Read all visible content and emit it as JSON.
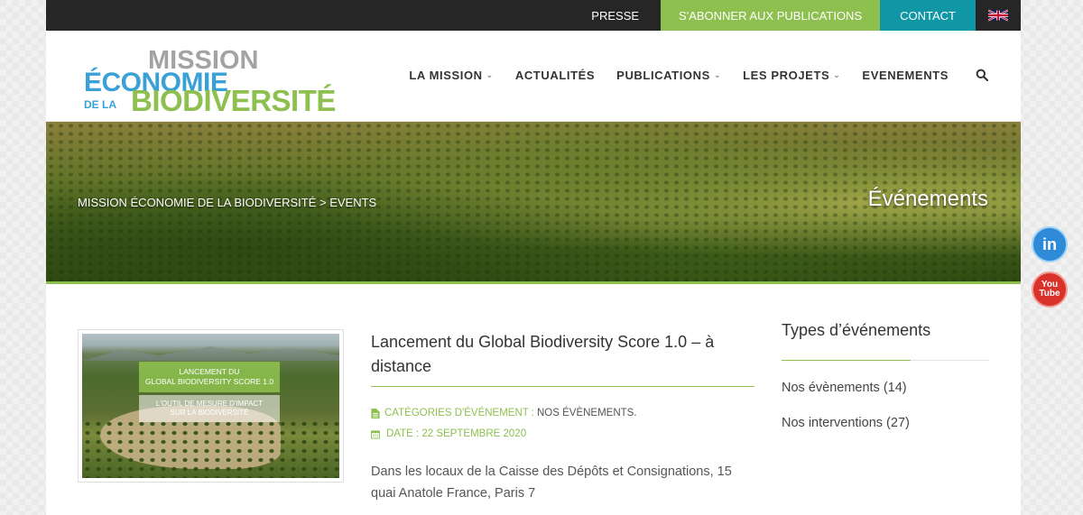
{
  "topbar": {
    "press": "PRESSE",
    "subscribe": "S'ABONNER AUX PUBLICATIONS",
    "contact": "CONTACT",
    "language_flag": "uk-flag-icon"
  },
  "logo": {
    "line1": "MISSION",
    "line2": "ÉCONOMIE",
    "line3": "DE LA",
    "line4": "BIODIVERSITÉ"
  },
  "nav": {
    "items": [
      {
        "label": "LA MISSION",
        "dropdown": true
      },
      {
        "label": "ACTUALITÉS",
        "dropdown": false
      },
      {
        "label": "PUBLICATIONS",
        "dropdown": true
      },
      {
        "label": "LES PROJETS",
        "dropdown": true
      },
      {
        "label": "EVENEMENTS",
        "dropdown": false
      }
    ],
    "search_icon": "search-icon"
  },
  "banner": {
    "breadcrumb": "MISSION ÉCONOMIE DE LA BIODIVERSITÉ > EVENTS",
    "title": "Événements"
  },
  "event": {
    "thumb_line1": "LANCEMENT DU",
    "thumb_line2": "GLOBAL BIODIVERSITY SCORE 1.0",
    "thumb_line3": "L'OUTIL DE MESURE D'IMPACT",
    "thumb_line4": "SUR LA BIODIVERSITÉ",
    "title": "Lancement du Global Biodiversity Score 1.0 – à distance",
    "category_label": "CATÉGORIES D'ÉVÉNEMENT :",
    "category_value": "NOS ÉVÈNEMENTS.",
    "date_label": "DATE : 22 SEPTEMBRE 2020",
    "description": "Dans les locaux de la Caisse des Dépôts et Consignations, 15 quai Anatole France, Paris 7"
  },
  "sidebar": {
    "title": "Types d’événements",
    "items": [
      {
        "label": "Nos évènements (14)"
      },
      {
        "label": "Nos interventions (27)"
      }
    ]
  },
  "social": {
    "linkedin": "in",
    "youtube_line1": "You",
    "youtube_line2": "Tube"
  },
  "colors": {
    "accent_green": "#8dc04f",
    "accent_teal": "#0f97a6",
    "logo_blue": "#3aa1d6",
    "topbar_bg": "#262626"
  }
}
